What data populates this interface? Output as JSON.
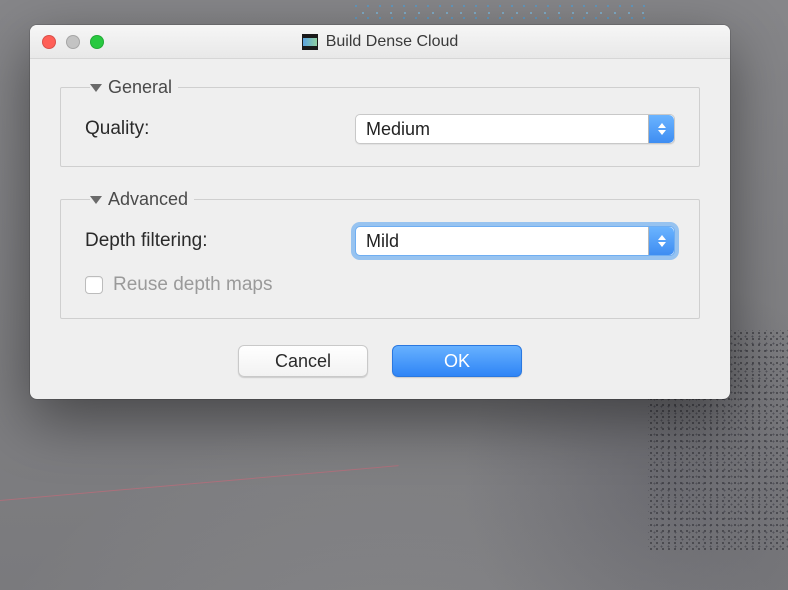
{
  "window": {
    "title": "Build Dense Cloud"
  },
  "sections": {
    "general": {
      "label": "General",
      "quality_label": "Quality:",
      "quality_value": "Medium"
    },
    "advanced": {
      "label": "Advanced",
      "depth_filtering_label": "Depth filtering:",
      "depth_filtering_value": "Mild",
      "reuse_depth_maps_label": "Reuse depth maps",
      "reuse_depth_maps_checked": false
    }
  },
  "buttons": {
    "cancel": "Cancel",
    "ok": "OK"
  }
}
